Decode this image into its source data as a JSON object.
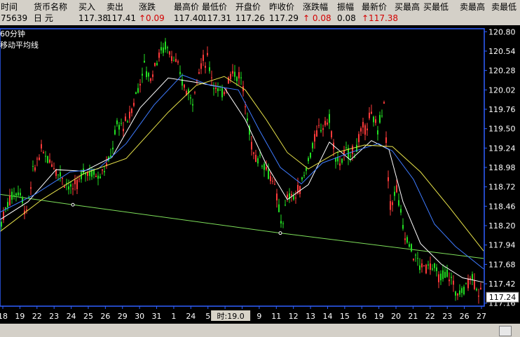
{
  "header": {
    "columns": [
      {
        "label": "时间",
        "value": "75639",
        "dir": ""
      },
      {
        "label": "货币名称",
        "value": "日  元",
        "dir": ""
      },
      {
        "label": "买入",
        "value": "117.38",
        "dir": ""
      },
      {
        "label": "卖出",
        "value": "117.41",
        "dir": ""
      },
      {
        "label": "涨跌",
        "value": "↑0.09",
        "dir": "up"
      },
      {
        "label": "最高价",
        "value": "117.40",
        "dir": ""
      },
      {
        "label": "最低价",
        "value": "117.31",
        "dir": ""
      },
      {
        "label": "开盘价",
        "value": "117.26",
        "dir": ""
      },
      {
        "label": "昨收价",
        "value": "117.29",
        "dir": ""
      },
      {
        "label": "涨跌幅",
        "value": "↑  0.08",
        "dir": "up"
      },
      {
        "label": "振幅",
        "value": "0.08",
        "dir": ""
      },
      {
        "label": "最新价",
        "value": "↑117.38",
        "dir": "up"
      },
      {
        "label": "买最高",
        "value": "",
        "dir": ""
      },
      {
        "label": "买最低",
        "value": "",
        "dir": ""
      },
      {
        "label": "卖最高",
        "value": "",
        "dir": ""
      },
      {
        "label": "卖最低",
        "value": "",
        "dir": ""
      }
    ]
  },
  "chart": {
    "period_label": "60分钟",
    "indicator_label": "移动平均线",
    "current_price_label": "117.24",
    "cursor_time_label": "时:19.0",
    "colors": {
      "up": "#ff3a3a",
      "down": "#22dd22",
      "ma1": "#ffffff",
      "ma2": "#3e7bff",
      "ma3": "#e8e34a",
      "trend": "#7ee05a",
      "axis": "#2f5fff",
      "text": "#ffffff"
    }
  },
  "chart_data": {
    "type": "candlestick",
    "y_ticks": [
      "120.80",
      "120.54",
      "120.28",
      "120.02",
      "119.76",
      "119.50",
      "119.24",
      "118.98",
      "118.72",
      "118.46",
      "118.20",
      "117.94",
      "117.68",
      "117.42",
      "117.16"
    ],
    "ylim": [
      117.12,
      120.84
    ],
    "x_ticks": [
      "18",
      "19",
      "22",
      "23",
      "24",
      "25",
      "26",
      "29",
      "30",
      "31",
      "1",
      "24",
      "5",
      "7",
      "8",
      "9",
      "11",
      "12",
      "13",
      "14",
      "15",
      "16",
      "19",
      "20",
      "21",
      "22",
      "23",
      "26",
      "27"
    ],
    "price_path": [
      [
        0,
        118.18
      ],
      [
        12,
        118.55
      ],
      [
        26,
        118.68
      ],
      [
        38,
        118.38
      ],
      [
        48,
        118.95
      ],
      [
        58,
        119.2
      ],
      [
        72,
        119.08
      ],
      [
        88,
        118.86
      ],
      [
        104,
        118.66
      ],
      [
        122,
        118.94
      ],
      [
        140,
        118.88
      ],
      [
        156,
        119.05
      ],
      [
        166,
        119.52
      ],
      [
        182,
        119.58
      ],
      [
        196,
        120.02
      ],
      [
        206,
        120.34
      ],
      [
        214,
        120.16
      ],
      [
        224,
        120.44
      ],
      [
        236,
        120.62
      ],
      [
        248,
        120.46
      ],
      [
        262,
        120.08
      ],
      [
        274,
        119.88
      ],
      [
        286,
        120.36
      ],
      [
        296,
        120.44
      ],
      [
        306,
        120.08
      ],
      [
        316,
        119.92
      ],
      [
        330,
        120.28
      ],
      [
        344,
        120.18
      ],
      [
        354,
        119.56
      ],
      [
        362,
        119.16
      ],
      [
        376,
        119.06
      ],
      [
        390,
        118.78
      ],
      [
        402,
        118.22
      ],
      [
        412,
        118.62
      ],
      [
        422,
        118.58
      ],
      [
        434,
        118.88
      ],
      [
        444,
        119.22
      ],
      [
        456,
        119.5
      ],
      [
        470,
        119.62
      ],
      [
        480,
        119.02
      ],
      [
        494,
        119.16
      ],
      [
        506,
        119.2
      ],
      [
        516,
        119.44
      ],
      [
        528,
        119.66
      ],
      [
        540,
        119.52
      ],
      [
        548,
        119.84
      ],
      [
        556,
        118.46
      ],
      [
        566,
        118.68
      ],
      [
        576,
        118.12
      ],
      [
        590,
        117.82
      ],
      [
        602,
        117.62
      ],
      [
        616,
        117.7
      ],
      [
        626,
        117.48
      ],
      [
        640,
        117.56
      ],
      [
        652,
        117.28
      ],
      [
        662,
        117.34
      ],
      [
        672,
        117.56
      ],
      [
        686,
        117.26
      ]
    ],
    "trendline": [
      [
        0,
        118.62
      ],
      [
        104,
        118.48
      ],
      [
        400,
        118.1
      ],
      [
        690,
        117.76
      ]
    ],
    "moving_averages": [
      {
        "name": "MA-short",
        "color": "ma1",
        "values": [
          [
            0,
            118.28
          ],
          [
            40,
            118.52
          ],
          [
            80,
            118.95
          ],
          [
            120,
            118.93
          ],
          [
            160,
            119.12
          ],
          [
            200,
            119.78
          ],
          [
            240,
            120.18
          ],
          [
            280,
            120.12
          ],
          [
            320,
            120.05
          ],
          [
            350,
            119.62
          ],
          [
            380,
            119.02
          ],
          [
            410,
            118.55
          ],
          [
            440,
            118.75
          ],
          [
            470,
            119.32
          ],
          [
            500,
            119.08
          ],
          [
            530,
            119.34
          ],
          [
            555,
            119.22
          ],
          [
            575,
            118.52
          ],
          [
            600,
            117.96
          ],
          [
            630,
            117.68
          ],
          [
            660,
            117.5
          ],
          [
            690,
            117.44
          ]
        ]
      },
      {
        "name": "MA-mid",
        "color": "ma2",
        "values": [
          [
            0,
            118.38
          ],
          [
            50,
            118.62
          ],
          [
            100,
            118.92
          ],
          [
            140,
            118.96
          ],
          [
            180,
            119.3
          ],
          [
            220,
            119.82
          ],
          [
            260,
            120.22
          ],
          [
            300,
            120.08
          ],
          [
            340,
            120.02
          ],
          [
            370,
            119.48
          ],
          [
            400,
            118.98
          ],
          [
            430,
            118.76
          ],
          [
            460,
            119.04
          ],
          [
            500,
            119.18
          ],
          [
            540,
            119.3
          ],
          [
            560,
            119.2
          ],
          [
            590,
            118.82
          ],
          [
            620,
            118.22
          ],
          [
            650,
            117.92
          ],
          [
            690,
            117.62
          ]
        ]
      },
      {
        "name": "MA-long",
        "color": "ma3",
        "values": [
          [
            0,
            118.12
          ],
          [
            60,
            118.55
          ],
          [
            120,
            118.9
          ],
          [
            180,
            119.1
          ],
          [
            240,
            119.72
          ],
          [
            280,
            120.08
          ],
          [
            320,
            120.2
          ],
          [
            350,
            120.02
          ],
          [
            380,
            119.62
          ],
          [
            410,
            119.18
          ],
          [
            440,
            118.96
          ],
          [
            480,
            119.18
          ],
          [
            520,
            119.28
          ],
          [
            560,
            119.26
          ],
          [
            600,
            118.92
          ],
          [
            640,
            118.46
          ],
          [
            690,
            117.86
          ]
        ]
      }
    ],
    "last_price": 117.24
  }
}
